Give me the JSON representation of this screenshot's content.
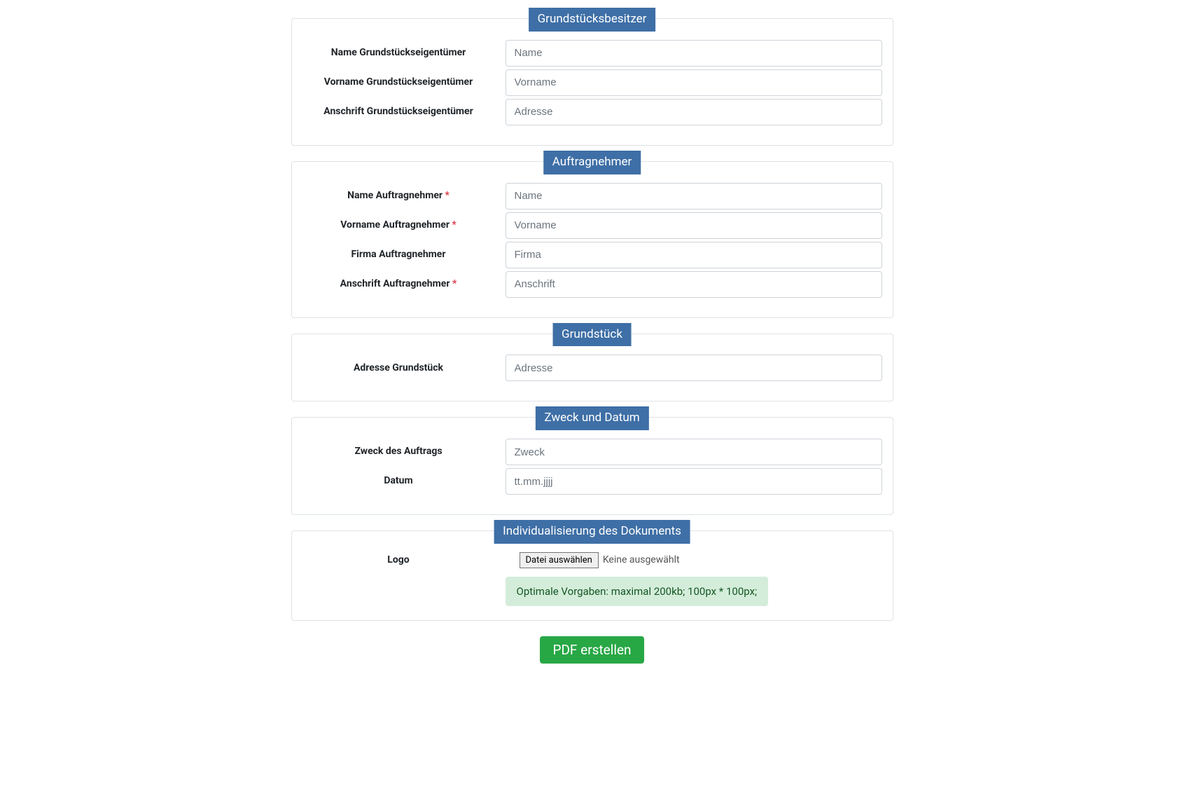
{
  "sections": {
    "owner": {
      "legend": "Grundstücksbesitzer",
      "fields": {
        "name": {
          "label": "Name Grundstückseigentümer",
          "placeholder": "Name",
          "required": false
        },
        "vorname": {
          "label": "Vorname Grundstückseigentümer",
          "placeholder": "Vorname",
          "required": false
        },
        "anschrift": {
          "label": "Anschrift Grundstückseigentümer",
          "placeholder": "Adresse",
          "required": false
        }
      }
    },
    "contractor": {
      "legend": "Auftragnehmer",
      "fields": {
        "name": {
          "label": "Name Auftragnehmer",
          "placeholder": "Name",
          "required": true
        },
        "vorname": {
          "label": "Vorname Auftragnehmer",
          "placeholder": "Vorname",
          "required": true
        },
        "firma": {
          "label": "Firma Auftragnehmer",
          "placeholder": "Firma",
          "required": false
        },
        "anschrift": {
          "label": "Anschrift Auftragnehmer",
          "placeholder": "Anschrift",
          "required": true
        }
      }
    },
    "property": {
      "legend": "Grundstück",
      "fields": {
        "adresse": {
          "label": "Adresse Grundstück",
          "placeholder": "Adresse",
          "required": false
        }
      }
    },
    "purpose": {
      "legend": "Zweck und Datum",
      "fields": {
        "zweck": {
          "label": "Zweck des Auftrags",
          "placeholder": "Zweck",
          "required": false
        },
        "datum": {
          "label": "Datum",
          "placeholder": "tt.mm.jjjj",
          "required": false
        }
      }
    },
    "customization": {
      "legend": "Individualisierung des Dokuments",
      "logo_label": "Logo",
      "file_button": "Datei auswählen",
      "file_status": "Keine ausgewählt",
      "hint": "Optimale Vorgaben: maximal 200kb; 100px * 100px;"
    }
  },
  "required_marker": " *",
  "submit_label": "PDF erstellen"
}
